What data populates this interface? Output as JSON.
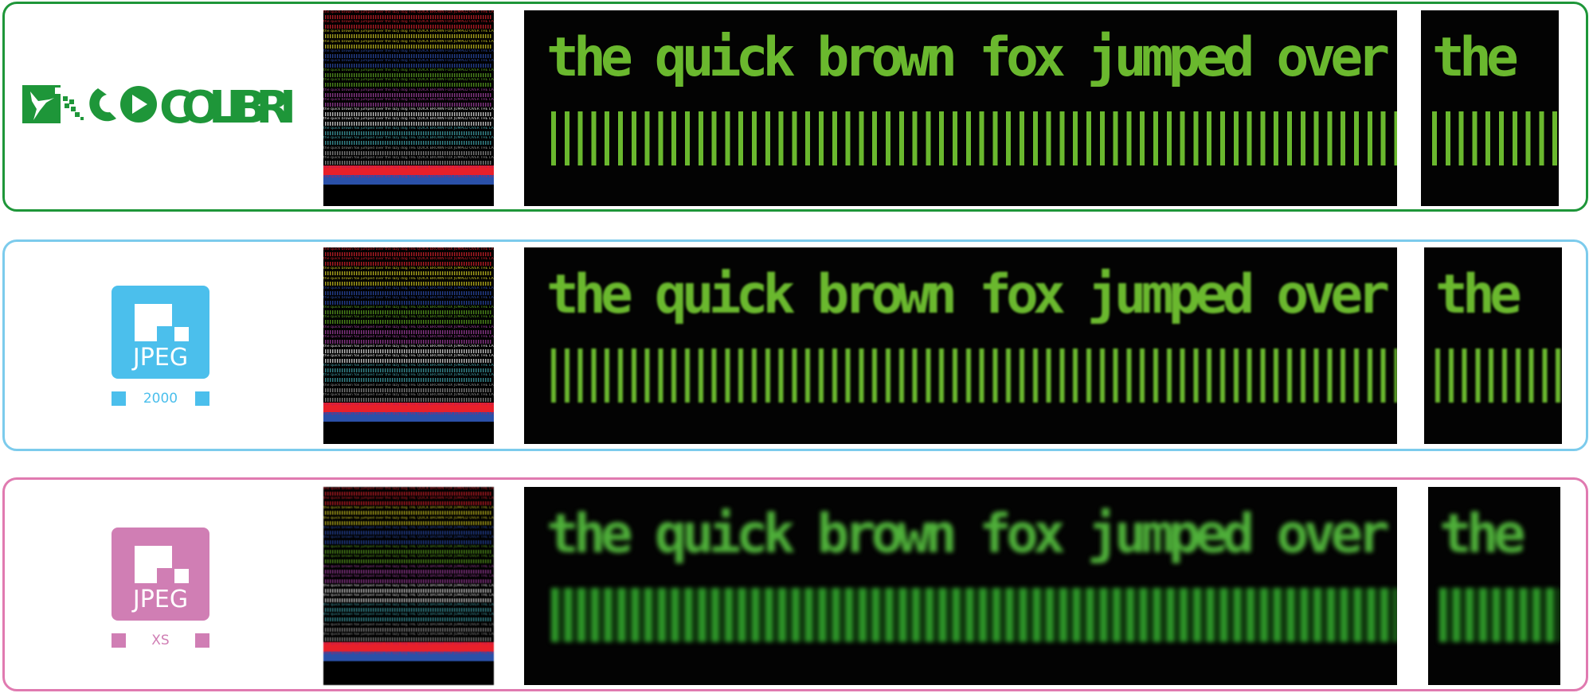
{
  "rows": [
    {
      "codec": "COLIBRI",
      "accent": "#1e9639"
    },
    {
      "codec": "JPEG",
      "variant": "2000",
      "accent": "#4bbfec"
    },
    {
      "codec": "JPEG",
      "variant": "XS",
      "accent": "#d07eb4"
    }
  ],
  "sample_text": "the quick brown fox jumped over t",
  "crop_text": "the",
  "thumbnail": {
    "line": "the quick brown fox jumped over the lazy dog  THE QUICK BROWN FOX JUMPED OVER THE LAZY DOG",
    "colors": [
      "#d0202a",
      "#d0202a",
      "#c8c020",
      "#c8c020",
      "#2a4aa8",
      "#2a4aa8",
      "#5aa020",
      "#5aa020",
      "#a040a0",
      "#a040a0",
      "#e0e0e0",
      "#e0e0e0",
      "#40a0a8",
      "#40a0a8",
      "#909090",
      "#909090"
    ],
    "band_colors": [
      "#e8202a",
      "#2a50a8"
    ]
  },
  "text_color": "#6ab82e"
}
